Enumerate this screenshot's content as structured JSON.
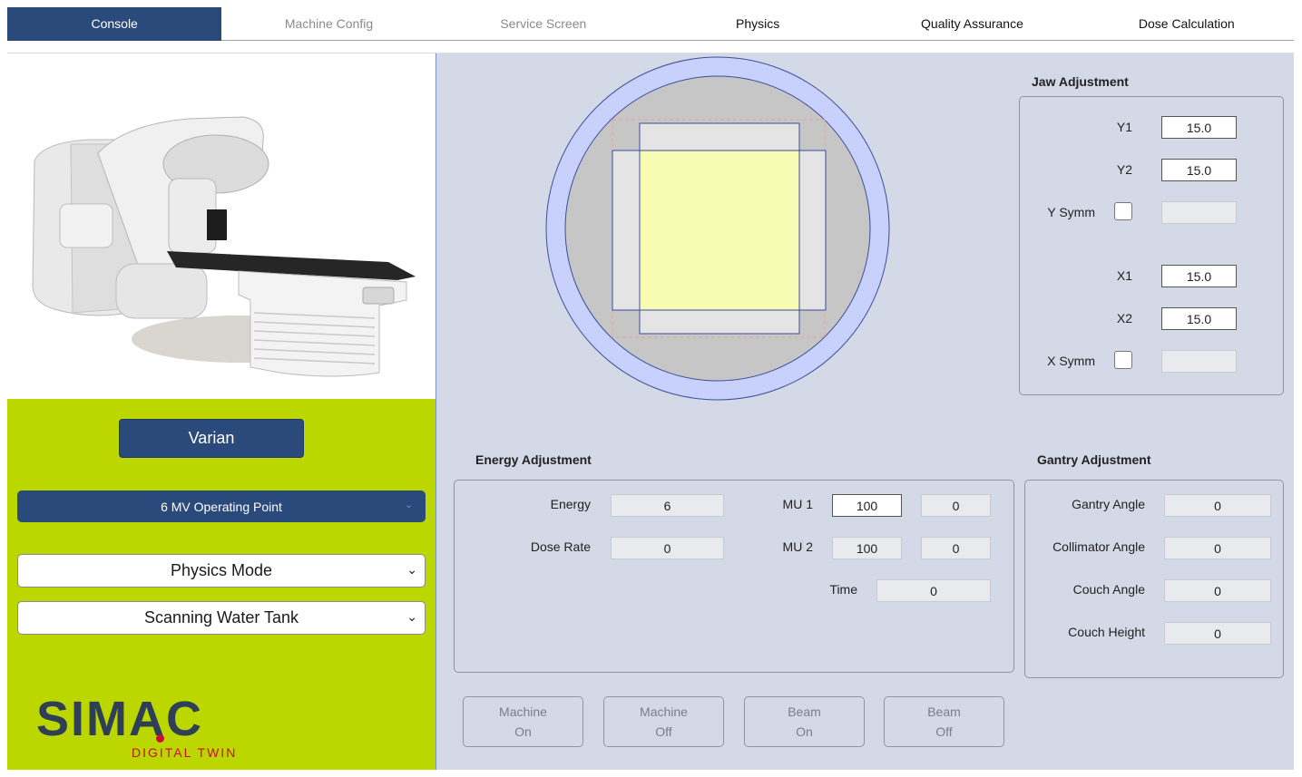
{
  "tabs": [
    {
      "label": "Console",
      "state": "active"
    },
    {
      "label": "Machine Config",
      "state": "disabled"
    },
    {
      "label": "Service Screen",
      "state": "disabled"
    },
    {
      "label": "Physics",
      "state": "normal"
    },
    {
      "label": "Quality Assurance",
      "state": "normal"
    },
    {
      "label": "Dose Calculation",
      "state": "normal"
    }
  ],
  "left": {
    "vendor": "Varian",
    "operating_point": "6 MV Operating Point",
    "mode": "Physics Mode",
    "accessory": "Scanning Water Tank",
    "logo": {
      "name": "SIMAC",
      "tagline": "DIGITAL TWIN"
    }
  },
  "jaw": {
    "title": "Jaw Adjustment",
    "y1_label": "Y1",
    "y1": "15.0",
    "y2_label": "Y2",
    "y2": "15.0",
    "ysymm_label": "Y Symm",
    "ysymm": "",
    "x1_label": "X1",
    "x1": "15.0",
    "x2_label": "X2",
    "x2": "15.0",
    "xsymm_label": "X Symm",
    "xsymm": ""
  },
  "energy": {
    "title": "Energy Adjustment",
    "energy_label": "Energy",
    "energy": "6",
    "dose_rate_label": "Dose Rate",
    "dose_rate": "0",
    "mu1_label": "MU 1",
    "mu1_set": "100",
    "mu1_actual": "0",
    "mu2_label": "MU 2",
    "mu2_set": "100",
    "mu2_actual": "0",
    "time_label": "Time",
    "time": "0"
  },
  "gantry": {
    "title": "Gantry Adjustment",
    "gantry_angle_label": "Gantry Angle",
    "gantry_angle": "0",
    "collimator_angle_label": "Collimator Angle",
    "collimator_angle": "0",
    "couch_angle_label": "Couch Angle",
    "couch_angle": "0",
    "couch_height_label": "Couch Height",
    "couch_height": "0"
  },
  "actions": {
    "machine_on": [
      "Machine",
      "On"
    ],
    "machine_off": [
      "Machine",
      "Off"
    ],
    "beam_on": [
      "Beam",
      "On"
    ],
    "beam_off": [
      "Beam",
      "Off"
    ]
  },
  "colors": {
    "accent": "#2b4a7c",
    "controls_bg": "#bcd600",
    "panel_bg": "#d3d9e6",
    "field_light": "#f7fbb4",
    "logo_red": "#c8102e"
  }
}
